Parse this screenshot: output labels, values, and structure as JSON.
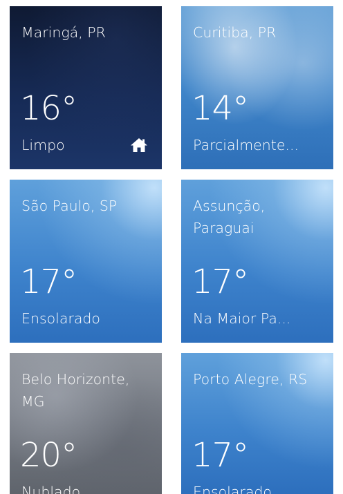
{
  "tiles": [
    {
      "city": "Maringá, PR",
      "temp": "16°",
      "condition": "Limpo",
      "is_home": true,
      "background": "night-sky",
      "color": "#162a55"
    },
    {
      "city": "Curitiba, PR",
      "temp": "14°",
      "condition": "Parcialmente...",
      "is_home": false,
      "background": "partly-cloudy",
      "color": "#3f85c9"
    },
    {
      "city": "São Paulo, SP",
      "temp": "17°",
      "condition": "Ensolarado",
      "is_home": false,
      "background": "sunny",
      "color": "#3e83cc"
    },
    {
      "city": "Assunção, Paraguai",
      "temp": "17°",
      "condition": "Na Maior Pa...",
      "is_home": false,
      "background": "sunny",
      "color": "#3e83cc"
    },
    {
      "city": "Belo Horizonte, MG",
      "temp": "20°",
      "condition": "Nublado",
      "is_home": false,
      "background": "cloudy",
      "color": "#757a83"
    },
    {
      "city": "Porto Alegre, RS",
      "temp": "17°",
      "condition": "Ensolarado",
      "is_home": false,
      "background": "sunny",
      "color": "#3e83cc"
    }
  ],
  "icons": {
    "home": "home-icon"
  }
}
